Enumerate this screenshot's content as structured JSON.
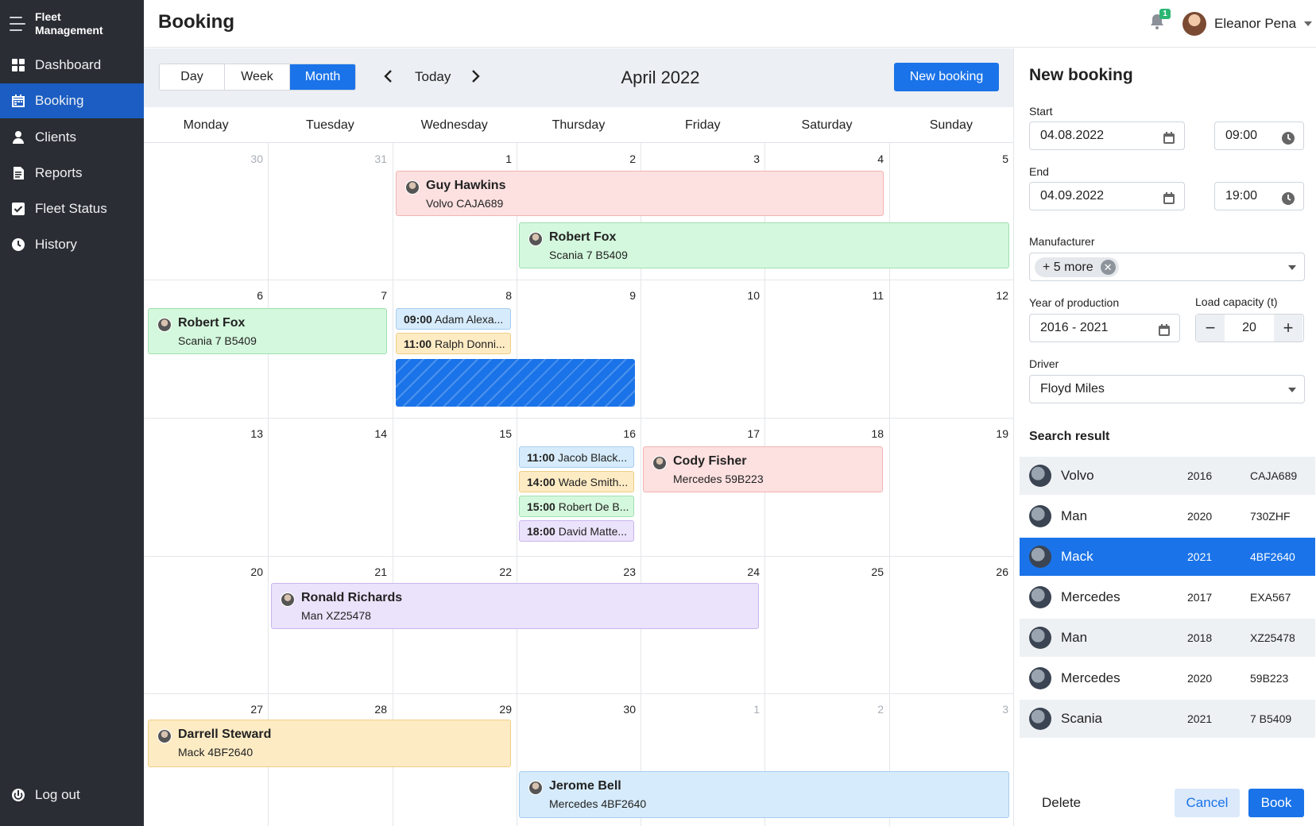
{
  "app": {
    "brand": "Fleet\nManagement",
    "brand_line1": "Fleet",
    "brand_line2": "Management"
  },
  "sidebar": {
    "items": [
      {
        "label": "Dashboard",
        "icon": "grid-icon"
      },
      {
        "label": "Booking",
        "icon": "calendar-icon",
        "active": true
      },
      {
        "label": "Clients",
        "icon": "person-icon"
      },
      {
        "label": "Reports",
        "icon": "document-icon"
      },
      {
        "label": "Fleet Status",
        "icon": "checkbox-icon"
      },
      {
        "label": "History",
        "icon": "clock-icon"
      }
    ],
    "logout": "Log out"
  },
  "header": {
    "title": "Booking",
    "notifications": "1",
    "user_name": "Eleanor Pena"
  },
  "calendar": {
    "views": [
      "Day",
      "Week",
      "Month"
    ],
    "active_view": "Month",
    "today": "Today",
    "month_title": "April 2022",
    "new_booking": "New booking",
    "weekdays": [
      "Monday",
      "Tuesday",
      "Wednesday",
      "Thursday",
      "Friday",
      "Saturday",
      "Sunday"
    ],
    "weeks": [
      [
        "30",
        "31",
        "1",
        "2",
        "3",
        "4",
        "5"
      ],
      [
        "6",
        "7",
        "8",
        "9",
        "10",
        "11",
        "12"
      ],
      [
        "13",
        "14",
        "15",
        "16",
        "17",
        "18",
        "19"
      ],
      [
        "20",
        "21",
        "22",
        "23",
        "24",
        "25",
        "26"
      ],
      [
        "27",
        "28",
        "29",
        "30",
        "1",
        "2",
        "3"
      ]
    ],
    "events": [
      {
        "name": "Guy Hawkins",
        "vehicle": "Volvo  CAJA689",
        "color": "pink"
      },
      {
        "name": "Robert Fox",
        "vehicle": "Scania  7 B5409",
        "color": "green"
      },
      {
        "name": "Robert Fox",
        "vehicle": "Scania  7 B5409",
        "color": "green"
      },
      {
        "name": "Cody Fisher",
        "vehicle": "Mercedes  59B223",
        "color": "pink"
      },
      {
        "name": "Ronald Richards",
        "vehicle": "Man  XZ25478",
        "color": "purple"
      },
      {
        "name": "Darrell Steward",
        "vehicle": "Mack  4BF2640",
        "color": "yellow"
      },
      {
        "name": "Jerome Bell",
        "vehicle": "Mercedes  4BF2640",
        "color": "blue"
      }
    ],
    "chips": [
      {
        "time": "09:00",
        "text": "Adam Alexa...",
        "color": "blue"
      },
      {
        "time": "11:00",
        "text": "Ralph Donni...",
        "color": "yellow"
      },
      {
        "time": "11:00",
        "text": "Jacob Black...",
        "color": "blue"
      },
      {
        "time": "14:00",
        "text": "Wade Smith...",
        "color": "yellow"
      },
      {
        "time": "15:00",
        "text": "Robert De B...",
        "color": "green"
      },
      {
        "time": "18:00",
        "text": "David Matte...",
        "color": "purple"
      }
    ]
  },
  "panel": {
    "title": "New booking",
    "start_label": "Start",
    "start_date": "04.08.2022",
    "start_time": "09:00",
    "end_label": "End",
    "end_date": "04.09.2022",
    "end_time": "19:00",
    "manufacturer_label": "Manufacturer",
    "manufacturer_tag": "+ 5 more",
    "year_label": "Year of production",
    "year_value": "2016 - 2021",
    "load_label": "Load capacity (t)",
    "load_value": "20",
    "driver_label": "Driver",
    "driver_value": "Floyd Miles",
    "search_title": "Search result",
    "results": [
      {
        "name": "Volvo",
        "year": "2016",
        "plate": "CAJA689"
      },
      {
        "name": "Man",
        "year": "2020",
        "plate": "730ZHF"
      },
      {
        "name": "Mack",
        "year": "2021",
        "plate": "4BF2640",
        "selected": true
      },
      {
        "name": "Mercedes",
        "year": "2017",
        "plate": "EXA567"
      },
      {
        "name": "Man",
        "year": "2018",
        "plate": "XZ25478"
      },
      {
        "name": "Mercedes",
        "year": "2020",
        "plate": "59B223"
      },
      {
        "name": "Scania",
        "year": "2021",
        "plate": "7 B5409"
      }
    ],
    "delete": "Delete",
    "cancel": "Cancel",
    "book": "Book"
  },
  "colors": {
    "sidebar_bg": "#2a2d33",
    "accent": "#1a73e8",
    "active_nav": "#1b5dc2"
  }
}
